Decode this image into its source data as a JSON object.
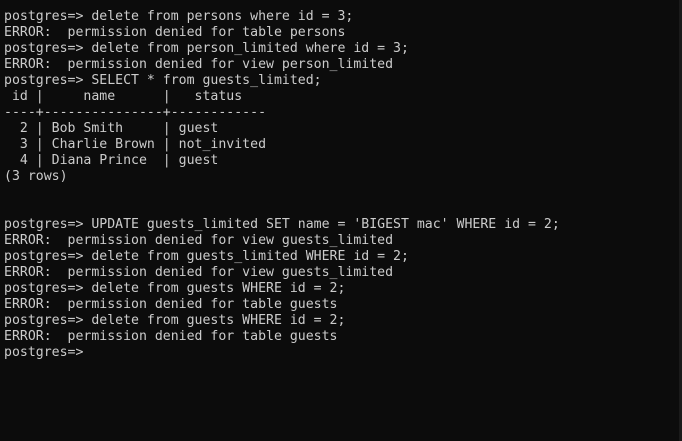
{
  "terminal": {
    "lines": [
      "postgres=> delete from persons where id = 3;",
      "ERROR:  permission denied for table persons",
      "postgres=> delete from person_limited where id = 3;",
      "ERROR:  permission denied for view person_limited",
      "postgres=> SELECT * from guests_limited;",
      " id |     name      |   status",
      "----+---------------+------------",
      "  2 | Bob Smith     | guest",
      "  3 | Charlie Brown | not_invited",
      "  4 | Diana Prince  | guest",
      "(3 rows)",
      "",
      "",
      "postgres=> UPDATE guests_limited SET name = 'BIGEST mac' WHERE id = 2;",
      "ERROR:  permission denied for view guests_limited",
      "postgres=> delete from guests_limited WHERE id = 2;",
      "ERROR:  permission denied for view guests_limited",
      "postgres=> delete from guests WHERE id = 2;",
      "ERROR:  permission denied for table guests",
      "postgres=> delete from guests WHERE id = 2;",
      "ERROR:  permission denied for table guests",
      "postgres=>"
    ]
  }
}
